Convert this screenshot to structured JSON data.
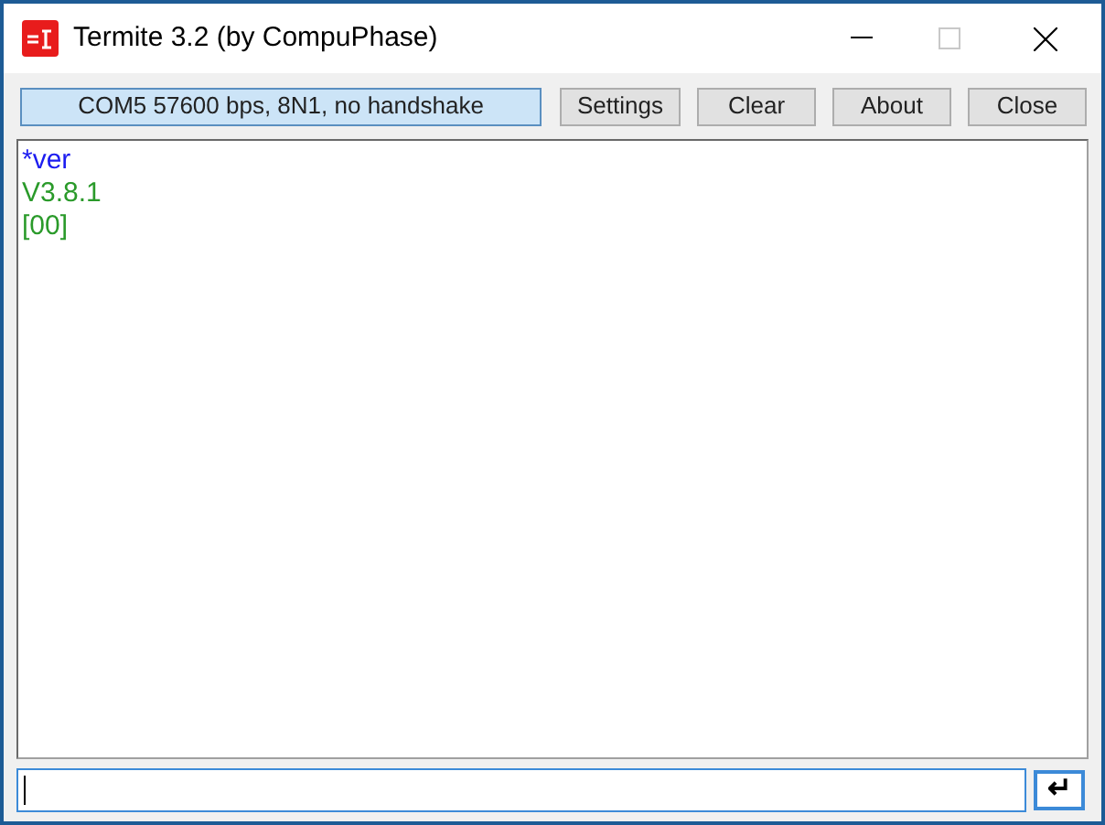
{
  "window": {
    "title": "Termite 3.2 (by CompuPhase)"
  },
  "toolbar": {
    "status": "COM5 57600 bps, 8N1, no handshake",
    "buttons": [
      "Settings",
      "Clear",
      "About",
      "Close"
    ]
  },
  "log": [
    {
      "kind": "sent",
      "text": "*ver"
    },
    {
      "kind": "received",
      "text": "V3.8.1"
    },
    {
      "kind": "received",
      "text": "[00]"
    }
  ],
  "input": {
    "focused": true,
    "send_button": "↵"
  }
}
